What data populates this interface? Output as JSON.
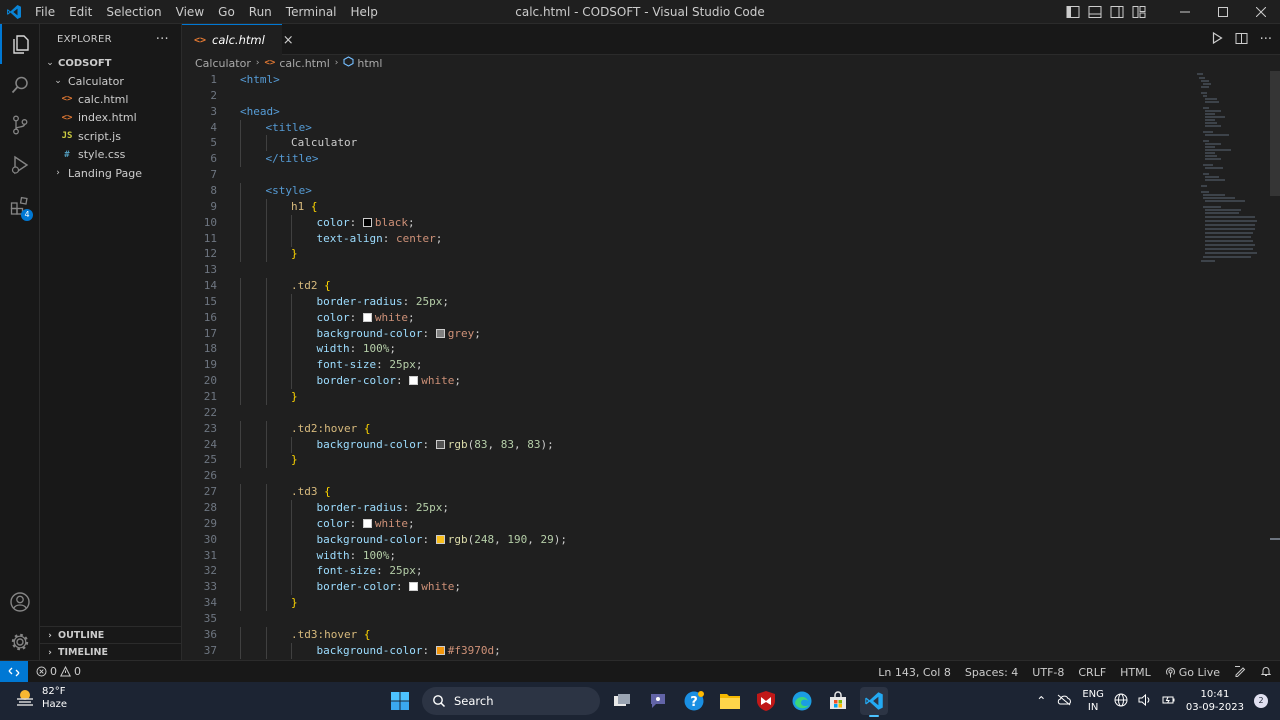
{
  "window": {
    "title": "calc.html - CODSOFT - Visual Studio Code",
    "menu": [
      "File",
      "Edit",
      "Selection",
      "View",
      "Go",
      "Run",
      "Terminal",
      "Help"
    ]
  },
  "activity_bar": {
    "extensions_badge": "4"
  },
  "explorer": {
    "header": "EXPLORER",
    "more": "···",
    "root": "CODSOFT",
    "folder": "Calculator",
    "files": [
      {
        "name": "calc.html",
        "icon": "<>",
        "icon_color": "#e37933"
      },
      {
        "name": "index.html",
        "icon": "<>",
        "icon_color": "#e37933"
      },
      {
        "name": "script.js",
        "icon": "JS",
        "icon_color": "#cbcb41"
      },
      {
        "name": "style.css",
        "icon": "#",
        "icon_color": "#519aba"
      }
    ],
    "other_folder": "Landing Page",
    "outline": "OUTLINE",
    "timeline": "TIMELINE"
  },
  "tab": {
    "label": "calc.html",
    "close": "×"
  },
  "breadcrumb": {
    "folder": "Calculator",
    "file": "calc.html",
    "symbol": "html"
  },
  "code_lines": [
    {
      "n": "1",
      "indent": 0,
      "tokens": [
        {
          "t": "<html>",
          "c": "t-tag"
        }
      ]
    },
    {
      "n": "2",
      "indent": 0,
      "tokens": []
    },
    {
      "n": "3",
      "indent": 0,
      "tokens": [
        {
          "t": "<head>",
          "c": "t-tag"
        }
      ]
    },
    {
      "n": "4",
      "indent": 1,
      "tokens": [
        {
          "t": "<title>",
          "c": "t-tag"
        }
      ]
    },
    {
      "n": "5",
      "indent": 2,
      "tokens": [
        {
          "t": "Calculator",
          "c": "t-txt"
        }
      ]
    },
    {
      "n": "6",
      "indent": 1,
      "tokens": [
        {
          "t": "</title>",
          "c": "t-tag"
        }
      ]
    },
    {
      "n": "7",
      "indent": 0,
      "tokens": []
    },
    {
      "n": "8",
      "indent": 1,
      "tokens": [
        {
          "t": "<style>",
          "c": "t-tag"
        }
      ]
    },
    {
      "n": "9",
      "indent": 2,
      "tokens": [
        {
          "t": "h1 ",
          "c": "t-sel"
        },
        {
          "t": "{",
          "c": "t-brace"
        }
      ]
    },
    {
      "n": "10",
      "indent": 3,
      "tokens": [
        {
          "t": "color",
          "c": "t-prop"
        },
        {
          "t": ": ",
          "c": "t-punc"
        },
        {
          "sw": "#000000"
        },
        {
          "t": "black",
          "c": "t-val"
        },
        {
          "t": ";",
          "c": "t-punc"
        }
      ]
    },
    {
      "n": "11",
      "indent": 3,
      "tokens": [
        {
          "t": "text-align",
          "c": "t-prop"
        },
        {
          "t": ": ",
          "c": "t-punc"
        },
        {
          "t": "center",
          "c": "t-val"
        },
        {
          "t": ";",
          "c": "t-punc"
        }
      ]
    },
    {
      "n": "12",
      "indent": 2,
      "tokens": [
        {
          "t": "}",
          "c": "t-brace"
        }
      ]
    },
    {
      "n": "13",
      "indent": 0,
      "tokens": []
    },
    {
      "n": "14",
      "indent": 2,
      "tokens": [
        {
          "t": ".td2 ",
          "c": "t-sel"
        },
        {
          "t": "{",
          "c": "t-brace"
        }
      ]
    },
    {
      "n": "15",
      "indent": 3,
      "tokens": [
        {
          "t": "border-radius",
          "c": "t-prop"
        },
        {
          "t": ": ",
          "c": "t-punc"
        },
        {
          "t": "25px",
          "c": "t-num"
        },
        {
          "t": ";",
          "c": "t-punc"
        }
      ]
    },
    {
      "n": "16",
      "indent": 3,
      "tokens": [
        {
          "t": "color",
          "c": "t-prop"
        },
        {
          "t": ": ",
          "c": "t-punc"
        },
        {
          "sw": "#ffffff"
        },
        {
          "t": "white",
          "c": "t-val"
        },
        {
          "t": ";",
          "c": "t-punc"
        }
      ]
    },
    {
      "n": "17",
      "indent": 3,
      "tokens": [
        {
          "t": "background-color",
          "c": "t-prop"
        },
        {
          "t": ": ",
          "c": "t-punc"
        },
        {
          "sw": "#808080"
        },
        {
          "t": "grey",
          "c": "t-val"
        },
        {
          "t": ";",
          "c": "t-punc"
        }
      ]
    },
    {
      "n": "18",
      "indent": 3,
      "tokens": [
        {
          "t": "width",
          "c": "t-prop"
        },
        {
          "t": ": ",
          "c": "t-punc"
        },
        {
          "t": "100%",
          "c": "t-num"
        },
        {
          "t": ";",
          "c": "t-punc"
        }
      ]
    },
    {
      "n": "19",
      "indent": 3,
      "tokens": [
        {
          "t": "font-size",
          "c": "t-prop"
        },
        {
          "t": ": ",
          "c": "t-punc"
        },
        {
          "t": "25px",
          "c": "t-num"
        },
        {
          "t": ";",
          "c": "t-punc"
        }
      ]
    },
    {
      "n": "20",
      "indent": 3,
      "tokens": [
        {
          "t": "border-color",
          "c": "t-prop"
        },
        {
          "t": ": ",
          "c": "t-punc"
        },
        {
          "sw": "#ffffff"
        },
        {
          "t": "white",
          "c": "t-val"
        },
        {
          "t": ";",
          "c": "t-punc"
        }
      ]
    },
    {
      "n": "21",
      "indent": 2,
      "tokens": [
        {
          "t": "}",
          "c": "t-brace"
        }
      ]
    },
    {
      "n": "22",
      "indent": 0,
      "tokens": []
    },
    {
      "n": "23",
      "indent": 2,
      "tokens": [
        {
          "t": ".td2:hover ",
          "c": "t-sel"
        },
        {
          "t": "{",
          "c": "t-brace"
        }
      ]
    },
    {
      "n": "24",
      "indent": 3,
      "tokens": [
        {
          "t": "background-color",
          "c": "t-prop"
        },
        {
          "t": ": ",
          "c": "t-punc"
        },
        {
          "sw": "#535353"
        },
        {
          "t": "rgb",
          "c": "t-fn"
        },
        {
          "t": "(",
          "c": "t-punc"
        },
        {
          "t": "83",
          "c": "t-num"
        },
        {
          "t": ", ",
          "c": "t-punc"
        },
        {
          "t": "83",
          "c": "t-num"
        },
        {
          "t": ", ",
          "c": "t-punc"
        },
        {
          "t": "83",
          "c": "t-num"
        },
        {
          "t": ");",
          "c": "t-punc"
        }
      ]
    },
    {
      "n": "25",
      "indent": 2,
      "tokens": [
        {
          "t": "}",
          "c": "t-brace"
        }
      ]
    },
    {
      "n": "26",
      "indent": 0,
      "tokens": []
    },
    {
      "n": "27",
      "indent": 2,
      "tokens": [
        {
          "t": ".td3 ",
          "c": "t-sel"
        },
        {
          "t": "{",
          "c": "t-brace"
        }
      ]
    },
    {
      "n": "28",
      "indent": 3,
      "tokens": [
        {
          "t": "border-radius",
          "c": "t-prop"
        },
        {
          "t": ": ",
          "c": "t-punc"
        },
        {
          "t": "25px",
          "c": "t-num"
        },
        {
          "t": ";",
          "c": "t-punc"
        }
      ]
    },
    {
      "n": "29",
      "indent": 3,
      "tokens": [
        {
          "t": "color",
          "c": "t-prop"
        },
        {
          "t": ": ",
          "c": "t-punc"
        },
        {
          "sw": "#ffffff"
        },
        {
          "t": "white",
          "c": "t-val"
        },
        {
          "t": ";",
          "c": "t-punc"
        }
      ]
    },
    {
      "n": "30",
      "indent": 3,
      "tokens": [
        {
          "t": "background-color",
          "c": "t-prop"
        },
        {
          "t": ": ",
          "c": "t-punc"
        },
        {
          "sw": "#f8be1d"
        },
        {
          "t": "rgb",
          "c": "t-fn"
        },
        {
          "t": "(",
          "c": "t-punc"
        },
        {
          "t": "248",
          "c": "t-num"
        },
        {
          "t": ", ",
          "c": "t-punc"
        },
        {
          "t": "190",
          "c": "t-num"
        },
        {
          "t": ", ",
          "c": "t-punc"
        },
        {
          "t": "29",
          "c": "t-num"
        },
        {
          "t": ");",
          "c": "t-punc"
        }
      ]
    },
    {
      "n": "31",
      "indent": 3,
      "tokens": [
        {
          "t": "width",
          "c": "t-prop"
        },
        {
          "t": ": ",
          "c": "t-punc"
        },
        {
          "t": "100%",
          "c": "t-num"
        },
        {
          "t": ";",
          "c": "t-punc"
        }
      ]
    },
    {
      "n": "32",
      "indent": 3,
      "tokens": [
        {
          "t": "font-size",
          "c": "t-prop"
        },
        {
          "t": ": ",
          "c": "t-punc"
        },
        {
          "t": "25px",
          "c": "t-num"
        },
        {
          "t": ";",
          "c": "t-punc"
        }
      ]
    },
    {
      "n": "33",
      "indent": 3,
      "tokens": [
        {
          "t": "border-color",
          "c": "t-prop"
        },
        {
          "t": ": ",
          "c": "t-punc"
        },
        {
          "sw": "#ffffff"
        },
        {
          "t": "white",
          "c": "t-val"
        },
        {
          "t": ";",
          "c": "t-punc"
        }
      ]
    },
    {
      "n": "34",
      "indent": 2,
      "tokens": [
        {
          "t": "}",
          "c": "t-brace"
        }
      ]
    },
    {
      "n": "35",
      "indent": 0,
      "tokens": []
    },
    {
      "n": "36",
      "indent": 2,
      "tokens": [
        {
          "t": ".td3:hover ",
          "c": "t-sel"
        },
        {
          "t": "{",
          "c": "t-brace"
        }
      ]
    },
    {
      "n": "37",
      "indent": 3,
      "tokens": [
        {
          "t": "background-color",
          "c": "t-prop"
        },
        {
          "t": ": ",
          "c": "t-punc"
        },
        {
          "sw": "#f3970d"
        },
        {
          "t": "#f3970d",
          "c": "t-val"
        },
        {
          "t": ";",
          "c": "t-punc"
        }
      ]
    }
  ],
  "status": {
    "errors": "0",
    "warnings": "0",
    "position": "Ln 143, Col 8",
    "spaces": "Spaces: 4",
    "encoding": "UTF-8",
    "eol": "CRLF",
    "language": "HTML",
    "golive": "Go Live"
  },
  "taskbar": {
    "temp": "82°F",
    "condition": "Haze",
    "search": "Search",
    "lang_top": "ENG",
    "lang_bottom": "IN",
    "time": "10:41",
    "date": "03-09-2023",
    "notifications": "2"
  },
  "colors": {
    "accent": "#0078d4",
    "editor_bg": "#1f1f1f",
    "sidebar_bg": "#181818",
    "taskbar_bg": "#1c2433"
  }
}
